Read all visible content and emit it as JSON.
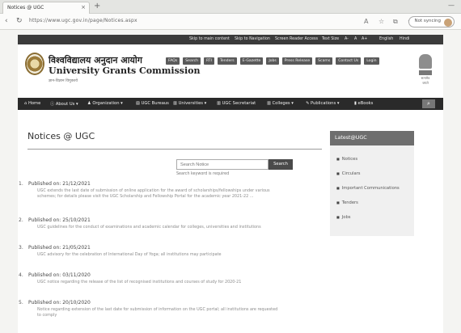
{
  "browser": {
    "tab_title": "Notices @ UGC",
    "tab_close": "×",
    "new_tab": "+",
    "window_controls": "—",
    "back_icon": "‹",
    "reload_icon": "↻",
    "url": "https://www.ugc.gov.in/page/Notices.aspx",
    "not_syncing": "Not syncing"
  },
  "topbar": {
    "skip_main": "Skip to main content",
    "skip_nav": "Skip to Navigation",
    "screen_reader": "Screen Reader Access",
    "text_size": "Text Size",
    "font_small": "A-",
    "font_normal": "A",
    "font_large": "A+",
    "lang_english": "English",
    "lang_hindi": "Hindi"
  },
  "header": {
    "title_hindi": "विश्वविद्यालय अनुदान आयोग",
    "title_english": "University Grants Commission",
    "tagline": "ज्ञान-विज्ञान विमुक्तये",
    "quick_links": [
      "FAQs",
      "Search",
      "RTI",
      "Tenders",
      "E-Gazette",
      "Jobs",
      "Press Release",
      "Scams",
      "Contact Us",
      "Login"
    ],
    "emblem_text": "सत्यमेव जयते"
  },
  "nav": {
    "items": [
      "Home",
      "About Us",
      "Organization",
      "UGC Bureaus",
      "Universities",
      "UGC Secretariat",
      "Colleges",
      "Publications",
      "eBooks"
    ],
    "search_icon": "search-icon"
  },
  "main": {
    "page_title": "Notices @ UGC",
    "search_placeholder": "Search Notice",
    "search_button": "Search",
    "search_hint": "Search keyword is required",
    "notices": [
      {
        "num": "1.",
        "date": "Published on: 21/12/2021",
        "desc": "UGC extends the last date of submission of online application for the award of scholarships/fellowships under various schemes; for details please visit the UGC Scholarship and Fellowship Portal for the academic year 2021-22 ..."
      },
      {
        "num": "2.",
        "date": "Published on: 25/10/2021",
        "desc": "UGC guidelines for the conduct of examinations and academic calendar for colleges, universities and institutions"
      },
      {
        "num": "3.",
        "date": "Published on: 21/05/2021",
        "desc": "UGC advisory for the celebration of International Day of Yoga; all institutions may participate"
      },
      {
        "num": "4.",
        "date": "Published on: 03/11/2020",
        "desc": "UGC notice regarding the release of the list of recognised institutions and courses of study for 2020-21"
      },
      {
        "num": "5.",
        "date": "Published on: 20/10/2020",
        "desc": "Notice regarding extension of the last date for submission of information on the UGC portal; all institutions are requested to comply"
      }
    ]
  },
  "sidebar": {
    "header": "Latest@UGC",
    "items": [
      "Notices",
      "Circulars",
      "Important Communications",
      "Tenders",
      "Jobs"
    ]
  }
}
